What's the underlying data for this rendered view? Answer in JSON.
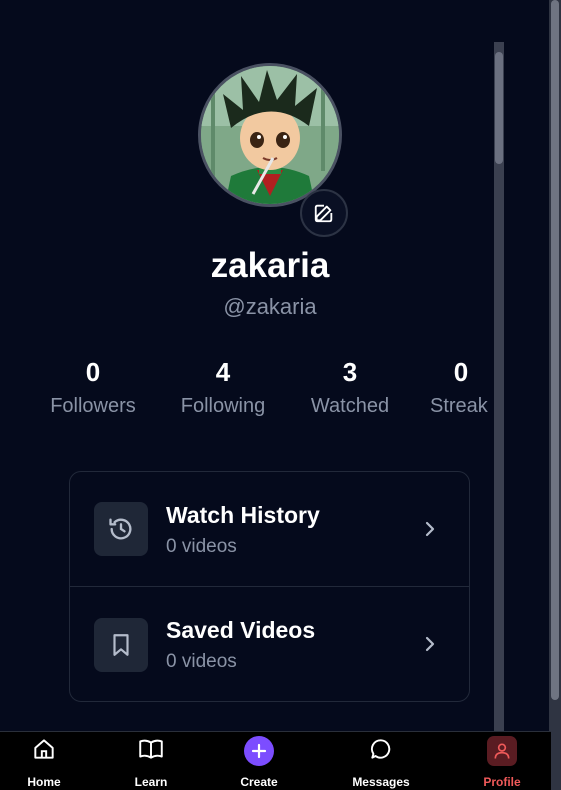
{
  "profile": {
    "username": "zakaria",
    "handle": "@zakaria"
  },
  "stats": [
    {
      "value": "0",
      "label": "Followers"
    },
    {
      "value": "4",
      "label": "Following"
    },
    {
      "value": "3",
      "label": "Watched"
    },
    {
      "value": "0",
      "label": "Streak"
    }
  ],
  "menu": {
    "watch_history": {
      "title": "Watch History",
      "subtitle": "0 videos",
      "icon": "history-icon"
    },
    "saved_videos": {
      "title": "Saved Videos",
      "subtitle": "0 videos",
      "icon": "bookmark-icon"
    }
  },
  "nav": {
    "items": [
      {
        "label": "Home",
        "icon": "home-icon"
      },
      {
        "label": "Learn",
        "icon": "book-icon"
      },
      {
        "label": "Create",
        "icon": "plus-icon"
      },
      {
        "label": "Messages",
        "icon": "chat-icon"
      },
      {
        "label": "Profile",
        "icon": "user-icon"
      }
    ],
    "active": "Profile"
  },
  "colors": {
    "background": "#050a1c",
    "create_accent": "#7c4dff",
    "active_nav": "#f05a5a",
    "muted_text": "#8a93a6"
  }
}
